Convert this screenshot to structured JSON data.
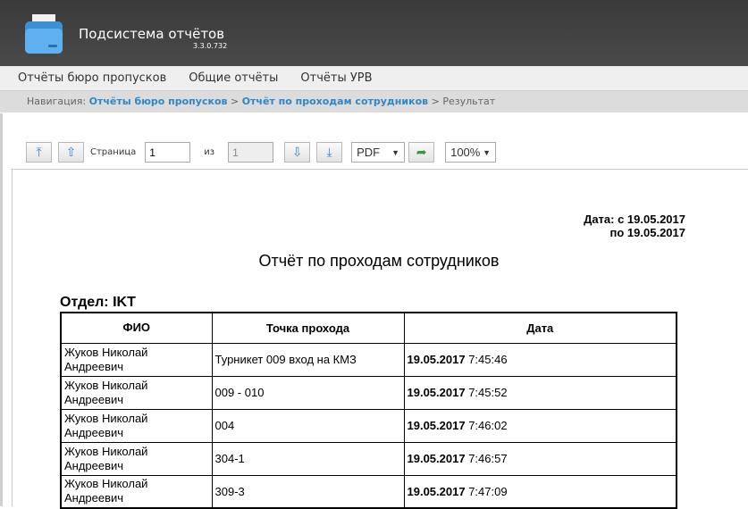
{
  "header": {
    "title": "Подсистема отчётов",
    "version": "3.3.0.732"
  },
  "menu": [
    "Отчёты бюро пропусков",
    "Общие отчёты",
    "Отчёты УРВ"
  ],
  "breadcrumb": {
    "label": "Навигация:",
    "links": [
      "Отчёты бюро пропусков",
      "Отчёт по проходам сотрудников"
    ],
    "sep": ">",
    "current": "Результат"
  },
  "toolbar": {
    "page_label": "Страница",
    "page": "1",
    "of_label": "из",
    "total": "1",
    "format": "PDF",
    "zoom": "100%"
  },
  "report": {
    "date_from": "Дата: с 19.05.2017",
    "date_to": "по 19.05.2017",
    "title": "Отчёт по проходам сотрудников",
    "department": "Отдел: IKT",
    "columns": [
      "ФИО",
      "Точка прохода",
      "Дата"
    ],
    "rows": [
      {
        "name": "Жуков Николай Андреевич",
        "point": "Турникет 009 вход на КМЗ",
        "date": "19.05.2017",
        "time": "7:45:46"
      },
      {
        "name": "Жуков Николай Андреевич",
        "point": "009 - 010",
        "date": "19.05.2017",
        "time": "7:45:52"
      },
      {
        "name": "Жуков Николай Андреевич",
        "point": "004",
        "date": "19.05.2017",
        "time": "7:46:02"
      },
      {
        "name": "Жуков Николай Андреевич",
        "point": "304-1",
        "date": "19.05.2017",
        "time": "7:46:57"
      },
      {
        "name": "Жуков Николай Андреевич",
        "point": "309-3",
        "date": "19.05.2017",
        "time": "7:47:09"
      }
    ]
  }
}
